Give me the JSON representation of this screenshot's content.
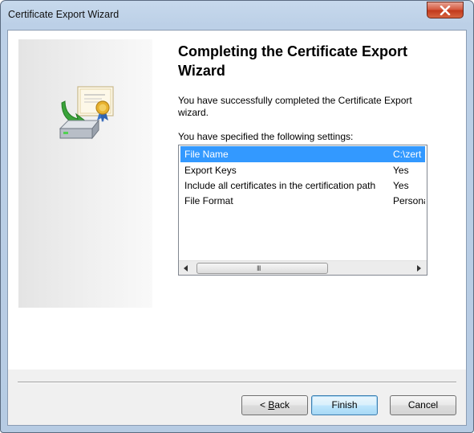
{
  "window": {
    "title": "Certificate Export Wizard",
    "close_icon": "close-icon"
  },
  "wizard": {
    "heading": "Completing the Certificate Export Wizard",
    "description": "You have successfully completed the Certificate Export wizard.",
    "settings_label": "You have specified the following settings:",
    "banner_icon": "certificate-export-icon"
  },
  "settings": {
    "rows": [
      {
        "key": "File Name",
        "value": "C:\\zert",
        "selected": true
      },
      {
        "key": "Export Keys",
        "value": "Yes",
        "selected": false
      },
      {
        "key": "Include all certificates in the certification path",
        "value": "Yes",
        "selected": false
      },
      {
        "key": "File Format",
        "value": "Persona",
        "selected": false
      }
    ],
    "scrollbar_grip": "III"
  },
  "buttons": {
    "back_prefix": "< ",
    "back_mnemonic": "B",
    "back_rest": "ack",
    "finish": "Finish",
    "cancel": "Cancel"
  },
  "colors": {
    "selection": "#3399ff",
    "close_button": "#c1391c",
    "default_button_border": "#3c7fb1"
  }
}
